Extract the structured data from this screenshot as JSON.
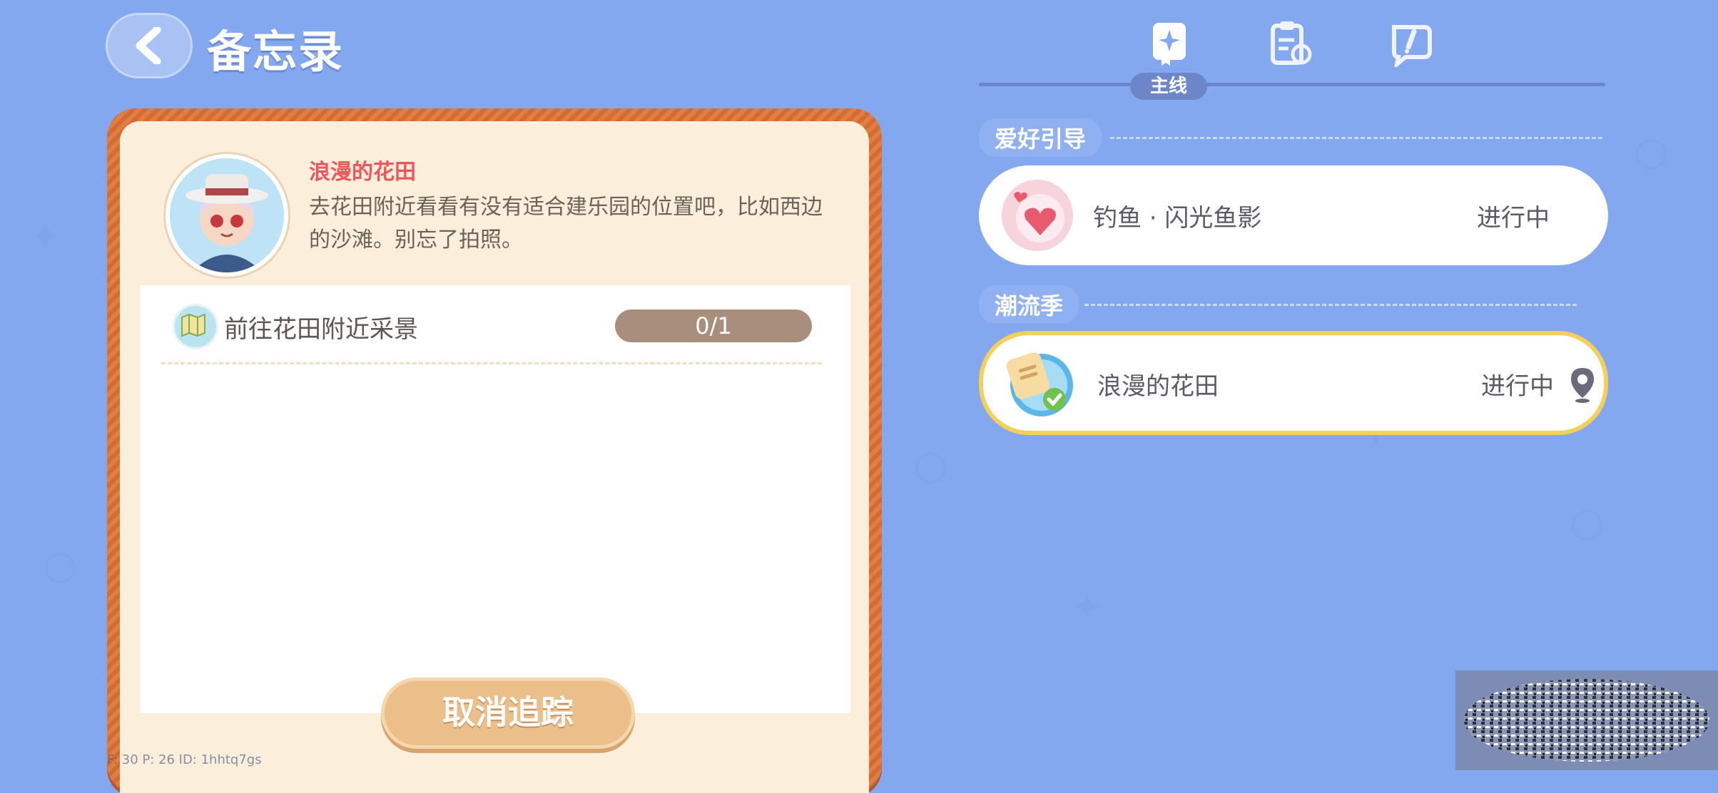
{
  "header": {
    "title": "备忘录",
    "back_icon": "chevron-left-icon"
  },
  "quest_detail": {
    "title": "浪漫的花田",
    "description": "去花田附近看看有没有适合建乐园的位置吧，比如西边的沙滩。别忘了拍照。",
    "avatar_icon": "npc-avatar-icon",
    "task": {
      "label": "前往花田附近采景",
      "progress_text": "0/1",
      "progress_fraction": 0,
      "icon": "map-icon"
    },
    "cancel_button": "取消追踪"
  },
  "tabs": {
    "items": [
      {
        "icon": "main-quest-book-icon",
        "label": "主线",
        "active": true
      },
      {
        "icon": "clipboard-refresh-icon",
        "active": false
      },
      {
        "icon": "speech-bubble-pen-icon",
        "active": false
      }
    ]
  },
  "sections": [
    {
      "label": "爱好引导",
      "quests": [
        {
          "name": "钓鱼 · 闪光鱼影",
          "status": "进行中",
          "icon": "heart-bubble-icon",
          "selected": false
        }
      ]
    },
    {
      "label": "潮流季",
      "quests": [
        {
          "name": "浪漫的花田",
          "status": "进行中",
          "icon": "notepad-check-icon",
          "selected": true,
          "pin_icon": "location-pin-icon"
        }
      ]
    }
  ],
  "debug": "F: 30    P: 26    ID: 1hhtq7gs",
  "colors": {
    "background": "#84a8ef",
    "frame": "#d46b32",
    "accent_red": "#f0555b",
    "selected_border": "#f6cf57"
  }
}
